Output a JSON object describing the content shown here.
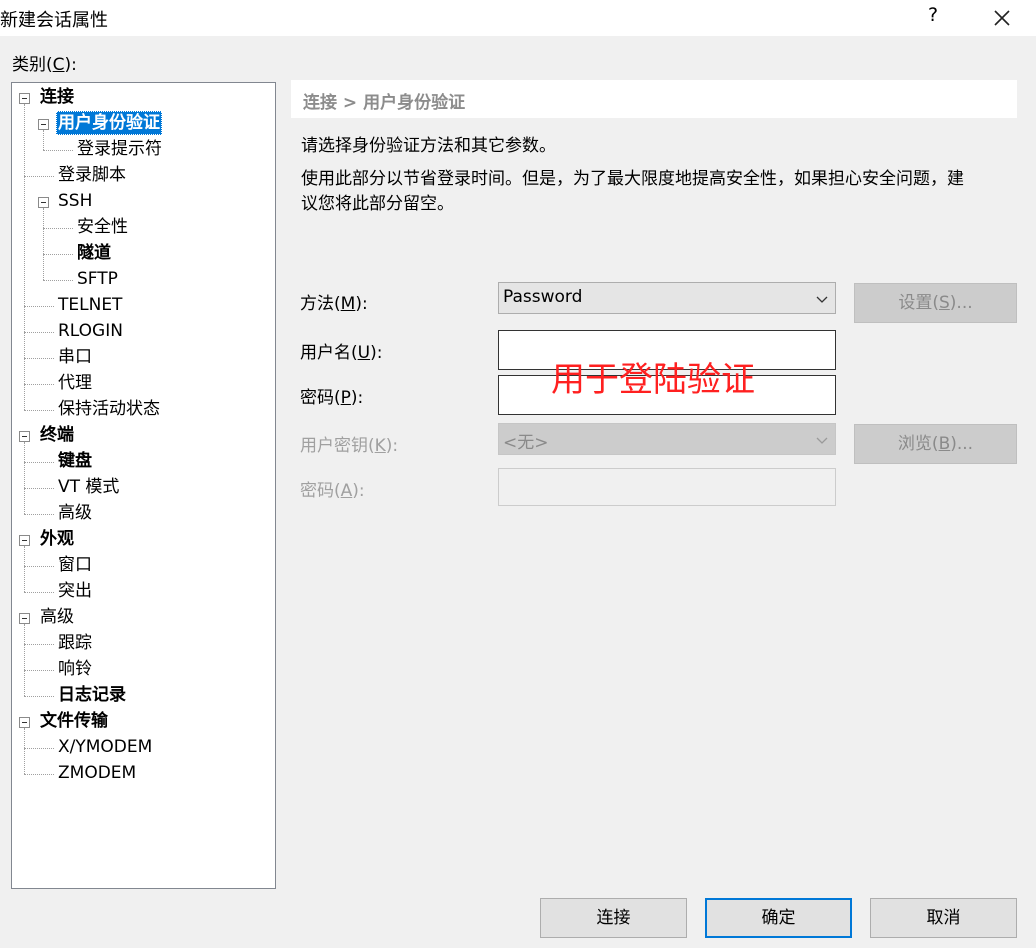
{
  "window": {
    "title": "新建会话属性",
    "help_label": "?",
    "close_icon": "close-icon"
  },
  "category_label": {
    "prefix": "类别(",
    "hotkey": "C",
    "suffix": "):"
  },
  "tree": {
    "items": [
      {
        "label": "连接",
        "level": 0,
        "bold": true,
        "expanded": true
      },
      {
        "label": "用户身份验证",
        "level": 1,
        "bold": true,
        "expanded": true,
        "selected": true
      },
      {
        "label": "登录提示符",
        "level": 2
      },
      {
        "label": "登录脚本",
        "level": 1
      },
      {
        "label": "SSH",
        "level": 1,
        "expanded": true
      },
      {
        "label": "安全性",
        "level": 2
      },
      {
        "label": "隧道",
        "level": 2,
        "bold": true
      },
      {
        "label": "SFTP",
        "level": 2
      },
      {
        "label": "TELNET",
        "level": 1
      },
      {
        "label": "RLOGIN",
        "level": 1
      },
      {
        "label": "串口",
        "level": 1
      },
      {
        "label": "代理",
        "level": 1
      },
      {
        "label": "保持活动状态",
        "level": 1
      },
      {
        "label": "终端",
        "level": 0,
        "bold": true,
        "expanded": true
      },
      {
        "label": "键盘",
        "level": 1,
        "bold": true
      },
      {
        "label": "VT 模式",
        "level": 1
      },
      {
        "label": "高级",
        "level": 1
      },
      {
        "label": "外观",
        "level": 0,
        "bold": true,
        "expanded": true
      },
      {
        "label": "窗口",
        "level": 1
      },
      {
        "label": "突出",
        "level": 1
      },
      {
        "label": "高级",
        "level": 0,
        "expanded": true
      },
      {
        "label": "跟踪",
        "level": 1
      },
      {
        "label": "响铃",
        "level": 1
      },
      {
        "label": "日志记录",
        "level": 1,
        "bold": true
      },
      {
        "label": "文件传输",
        "level": 0,
        "bold": true,
        "expanded": true
      },
      {
        "label": "X/YMODEM",
        "level": 1
      },
      {
        "label": "ZMODEM",
        "level": 1
      }
    ]
  },
  "panel": {
    "breadcrumb": "连接 > 用户身份验证",
    "desc1": "请选择身份验证方法和其它参数。",
    "desc2_line1": "使用此部分以节省登录时间。但是，为了最大限度地提高安全性，如果担心安全问题，建",
    "desc2_line2": "议您将此部分留空。"
  },
  "form": {
    "method": {
      "label_prefix": "方法(",
      "hotkey": "M",
      "label_suffix": "):",
      "value": "Password"
    },
    "settings_button": {
      "prefix": "设置(",
      "hotkey": "S",
      "suffix": ")..."
    },
    "username": {
      "label_prefix": "用户名(",
      "hotkey": "U",
      "label_suffix": "):",
      "value": ""
    },
    "password": {
      "label_prefix": "密码(",
      "hotkey": "P",
      "label_suffix": "):",
      "value": ""
    },
    "user_key": {
      "label_prefix": "用户密钥(",
      "hotkey": "K",
      "label_suffix": "):",
      "value": "<无>"
    },
    "browse_button": {
      "prefix": "浏览(",
      "hotkey": "B",
      "suffix": ")..."
    },
    "passphrase": {
      "label_prefix": "密码(",
      "hotkey": "A",
      "label_suffix": "):",
      "value": ""
    }
  },
  "annotation": "用于登陆验证",
  "buttons": {
    "connect": "连接",
    "ok": "确定",
    "cancel": "取消"
  },
  "colors": {
    "selection": "#0078d7",
    "annotation": "#ff2020",
    "disabled_text": "#a0a0a0"
  }
}
